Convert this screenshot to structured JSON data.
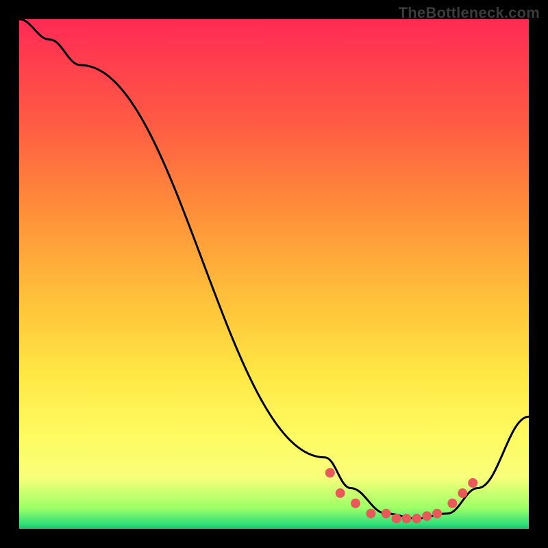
{
  "watermark": "TheBottleneck.com",
  "chart_data": {
    "type": "line",
    "title": "",
    "xlabel": "",
    "ylabel": "",
    "xlim": [
      0,
      100
    ],
    "ylim": [
      0,
      100
    ],
    "series": [
      {
        "name": "bottleneck-curve",
        "x": [
          0,
          6,
          12,
          60,
          65,
          72,
          78,
          84,
          90,
          100
        ],
        "values": [
          100,
          96,
          91,
          14,
          8,
          3,
          2,
          3,
          8,
          22
        ]
      },
      {
        "name": "optimal-range-markers",
        "x": [
          61,
          63,
          66,
          69,
          72,
          74,
          76,
          78,
          80,
          82,
          85,
          87,
          89
        ],
        "values": [
          11,
          7,
          5,
          3,
          3,
          2,
          2,
          2,
          2.5,
          3,
          5,
          7,
          9
        ]
      }
    ],
    "gradient_stops": [
      {
        "pos": 0.0,
        "color": "#ff2a55"
      },
      {
        "pos": 0.2,
        "color": "#ff5a44"
      },
      {
        "pos": 0.36,
        "color": "#ff8a3a"
      },
      {
        "pos": 0.55,
        "color": "#ffc13a"
      },
      {
        "pos": 0.7,
        "color": "#ffe845"
      },
      {
        "pos": 0.82,
        "color": "#fffb62"
      },
      {
        "pos": 0.9,
        "color": "#f8ff7a"
      },
      {
        "pos": 0.96,
        "color": "#9bff66"
      },
      {
        "pos": 0.99,
        "color": "#33e07a"
      },
      {
        "pos": 1.0,
        "color": "#1bc46a"
      }
    ],
    "curve_color": "#000000",
    "marker_color": "#e85a5a"
  }
}
